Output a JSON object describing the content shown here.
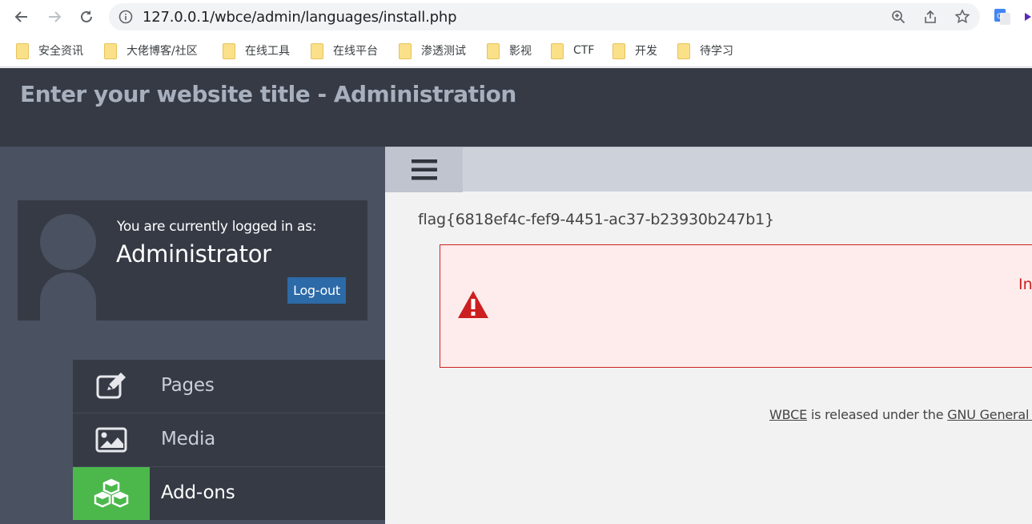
{
  "browser": {
    "url": "127.0.0.1/wbce/admin/languages/install.php",
    "bookmarks": [
      "安全资讯",
      "大佬博客/社区",
      "在线工具",
      "在线平台",
      "渗透测试",
      "影视",
      "CTF",
      "开发",
      "待学习"
    ]
  },
  "header": {
    "title": "Enter your website title - Administration"
  },
  "user": {
    "logged_label": "You are currently logged in as:",
    "name": "Administrator",
    "logout": "Log-out"
  },
  "menu": [
    {
      "label": "Pages",
      "icon": "edit-icon"
    },
    {
      "label": "Media",
      "icon": "image-icon"
    },
    {
      "label": "Add-ons",
      "icon": "cubes-icon",
      "active": true
    }
  ],
  "main": {
    "flag": "flag{6818ef4c-fef9-4451-ac37-b23930b247b1}",
    "alert_text": "In",
    "footer": {
      "link1": "WBCE",
      "middle": " is released under the ",
      "link2": "GNU General P"
    }
  },
  "colors": {
    "header": "#353a45",
    "sidebar": "#4a5160",
    "active": "#4cb84c",
    "alert_border": "#cc2222",
    "logout": "#2c6aa8"
  }
}
